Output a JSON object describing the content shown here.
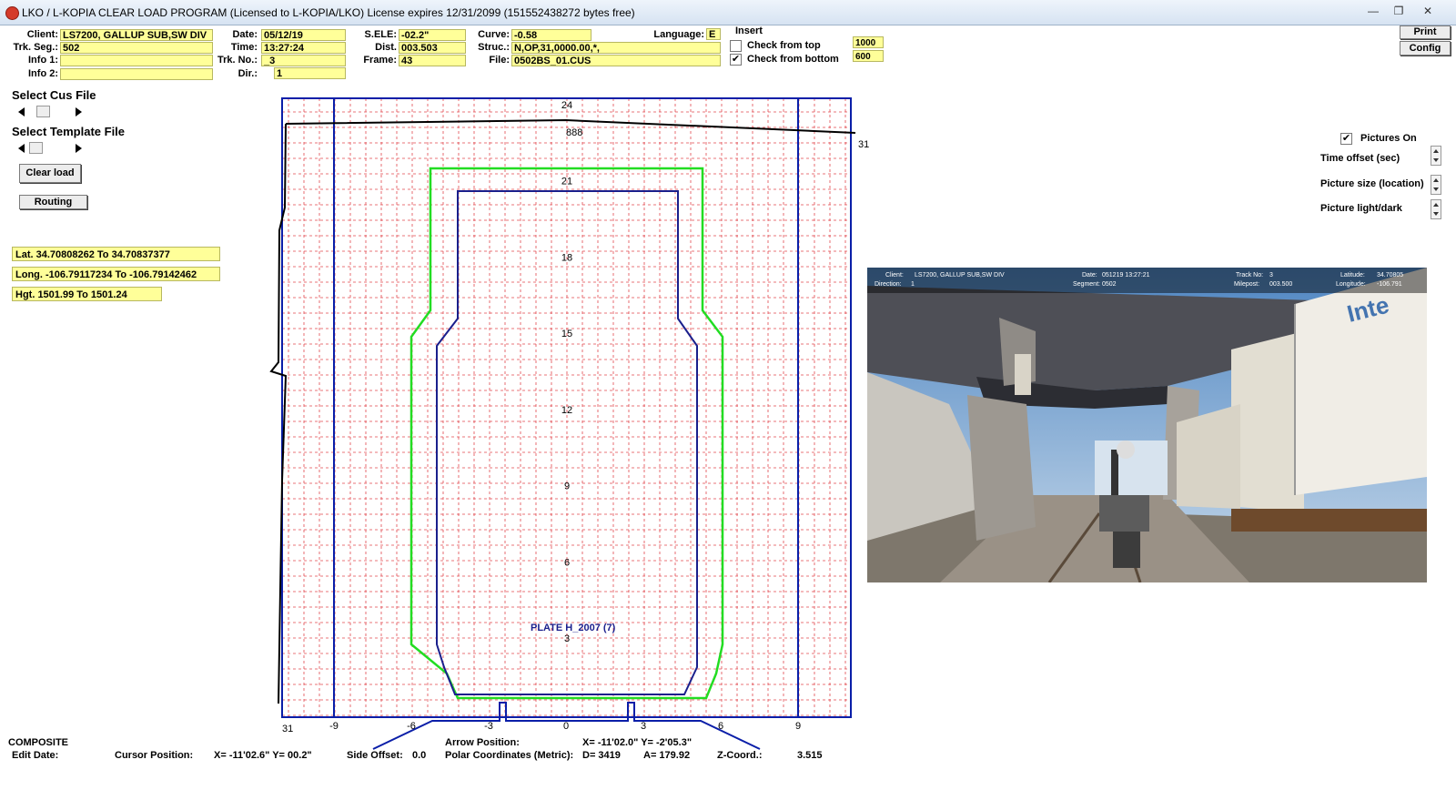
{
  "window": {
    "title": "LKO / L-KOPIA CLEAR LOAD PROGRAM   (Licensed to L-KOPIA/LKO)    License expires 12/31/2099    (151552438272 bytes free)",
    "minimize": "—",
    "maximize": "❐",
    "close": "✕"
  },
  "header": {
    "client": {
      "label": "Client:",
      "value": "LS7200, GALLUP SUB,SW DIV"
    },
    "trk_seg": {
      "label": "Trk. Seg.:",
      "value": "502"
    },
    "info1": {
      "label": "Info 1:",
      "value": ""
    },
    "info2": {
      "label": "Info 2:",
      "value": ""
    },
    "date": {
      "label": "Date:",
      "value": "05/12/19"
    },
    "time": {
      "label": "Time:",
      "value": "13:27:24"
    },
    "trk_no": {
      "label": "Trk. No.:",
      "value": "_3"
    },
    "dir": {
      "label": "Dir.:",
      "value": "1"
    },
    "sele": {
      "label": "S.ELE:",
      "value": "-02.2\""
    },
    "dist": {
      "label": "Dist.",
      "value": "003.503"
    },
    "frame": {
      "label": "Frame:",
      "value": "43"
    },
    "curve": {
      "label": "Curve:",
      "value": "-0.58"
    },
    "struc": {
      "label": "Struc.:",
      "value": "N,OP,31,0000.00,*,"
    },
    "file": {
      "label": "File:",
      "value": "0502BS_01.CUS"
    },
    "language": {
      "label": "Language:",
      "value": "E"
    },
    "insert_label": "Insert",
    "check_top": {
      "label": "Check from top",
      "checked": false,
      "value": "1000"
    },
    "check_bottom": {
      "label": "Check from bottom",
      "checked": true,
      "value": "600"
    },
    "print_label": "Print",
    "config_label": "Config"
  },
  "left": {
    "select_cus": "Select Cus File",
    "select_template": "Select Template File",
    "clear_load": "Clear load",
    "routing": "Routing",
    "lat": "Lat. 34.70808262 To 34.70837377",
    "long": "Long. -106.79117234 To -106.79142462",
    "hgt": "Hgt. 1501.99 To 1501.24"
  },
  "right": {
    "pictures_on": {
      "label": "Pictures On",
      "checked": true
    },
    "time_offset": "Time offset (sec)",
    "picture_size": "Picture size (location)",
    "picture_light": "Picture light/dark"
  },
  "photo_overlay": {
    "client_label": "Client:",
    "client_value": "LS7200, GALLUP SUB,SW DIV",
    "direction_label": "Direction:",
    "direction_value": "1",
    "date_label": "Date:",
    "date_value": "051219 13:27:21",
    "segment_label": "Segment:",
    "segment_value": "0502",
    "track_label": "Track No:",
    "track_value": "3",
    "milepost_label": "Milepost:",
    "milepost_value": "003.500",
    "lat_label": "Latitude:",
    "lat_value": "34.70805",
    "long_label": "Longitude:",
    "long_value": "-106.791",
    "sign_text": "Inte"
  },
  "plot": {
    "y_labels": [
      "24",
      "21",
      "18",
      "15",
      "12",
      "9",
      "6",
      "3"
    ],
    "x_labels": [
      "-9",
      "-6",
      "-3",
      "0",
      "3",
      "6",
      "9"
    ],
    "profile_top_label": "888",
    "right_label": "31",
    "bottom_left_label": "31",
    "plate_label": "PLATE H_2007  (7)",
    "colors": {
      "grid": "#e2484f",
      "frame": "#0a1ea8",
      "clearance": "#22dd22",
      "plate": "#1a1f8c",
      "profile": "#000000"
    }
  },
  "status": {
    "composite": "COMPOSITE",
    "edit_date": "Edit Date:",
    "cursor_label": "Cursor Position:",
    "cursor_value": "X=  -11'02.6\" Y=  00.2\"",
    "side_offset_label": "Side Offset:",
    "side_offset_value": "0.0",
    "arrow_label": "Arrow Position:",
    "arrow_value": "X= -11'02.0\" Y=  -2'05.3\"",
    "polar_label": "Polar Coordinates (Metric):",
    "polar_d": "D=  3419",
    "polar_a": "A=  179.92",
    "z_label": "Z-Coord.:",
    "z_value": "3.515"
  }
}
